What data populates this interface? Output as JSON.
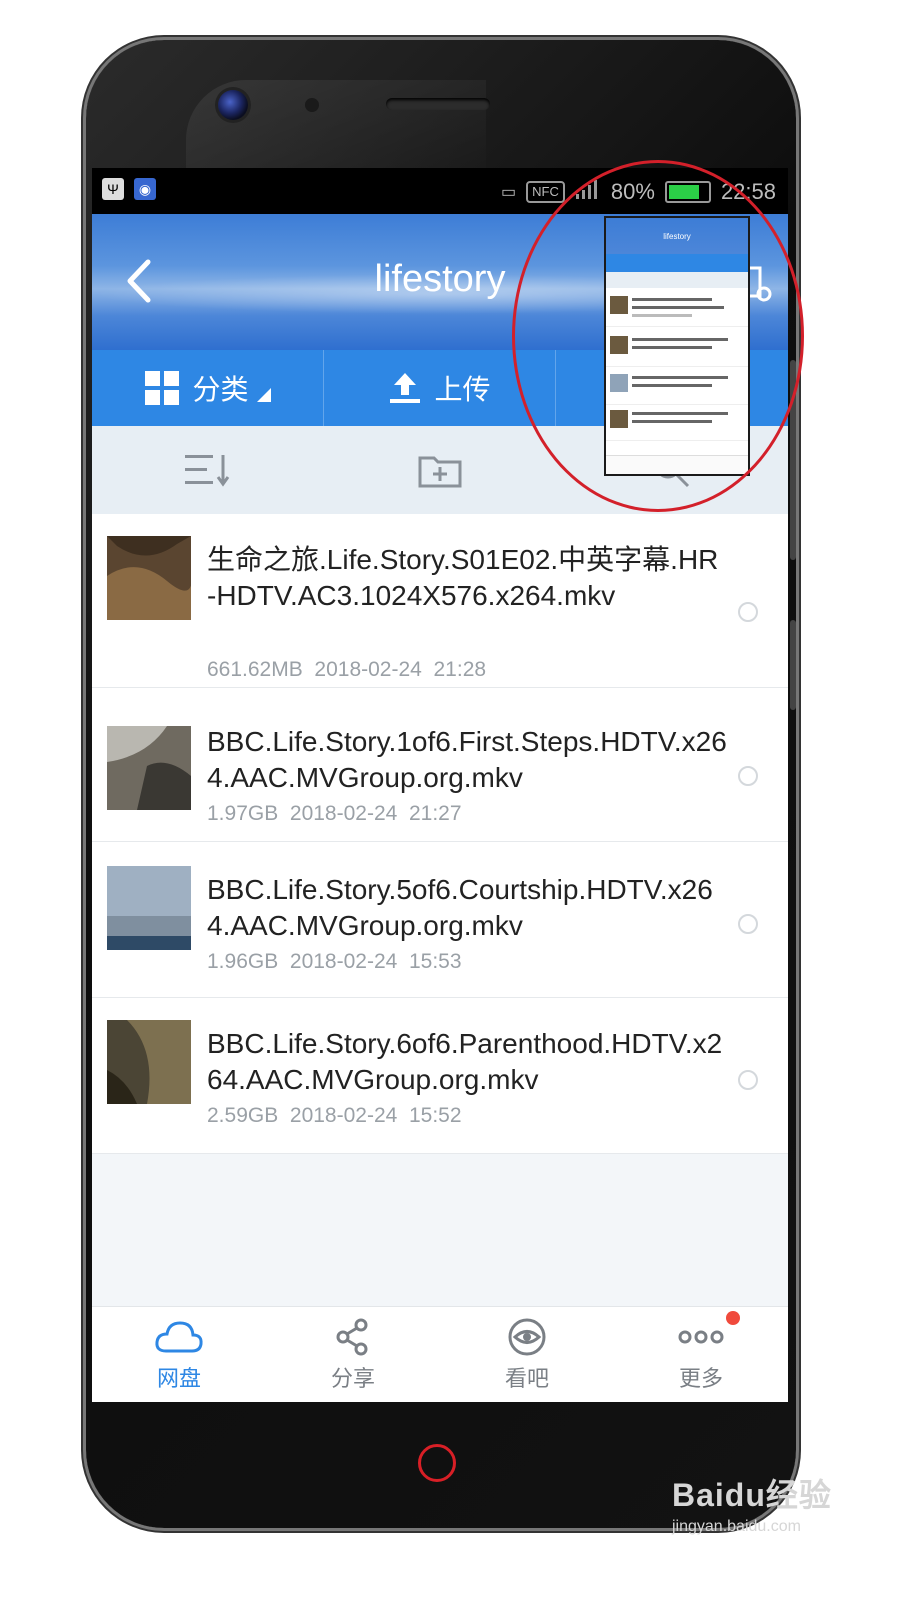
{
  "status_bar": {
    "nfc": "NFC",
    "battery": "80%",
    "time": "22:58"
  },
  "header": {
    "title": "lifestory"
  },
  "action_bar": {
    "items": [
      {
        "label": "分类"
      },
      {
        "label": "上传"
      }
    ]
  },
  "files": [
    {
      "name": "生命之旅.Life.Story.S01E02.中英字幕.HR-HDTV.AC3.1024X576.x264.mkv",
      "size": "661.62MB",
      "date": "2018-02-24  21:28",
      "thumb_colors": [
        "#5a4530",
        "#8a6a44",
        "#3e2f20"
      ]
    },
    {
      "name": "BBC.Life.Story.1of6.First.Steps.HDTV.x264.AAC.MVGroup.org.mkv",
      "size": "1.97GB",
      "date": "2018-02-24  21:27",
      "thumb_colors": [
        "#b9b7b0",
        "#6f6a60",
        "#3a3833"
      ]
    },
    {
      "name": "BBC.Life.Story.5of6.Courtship.HDTV.x264.AAC.MVGroup.org.mkv",
      "size": "1.96GB",
      "date": "2018-02-24  15:53",
      "thumb_colors": [
        "#9fb0c2",
        "#7f8f9f",
        "#2e4a66"
      ]
    },
    {
      "name": "BBC.Life.Story.6of6.Parenthood.HDTV.x264.AAC.MVGroup.org.mkv",
      "size": "2.59GB",
      "date": "2018-02-24  15:52",
      "thumb_colors": [
        "#4b4535",
        "#7d7050",
        "#2a2518"
      ]
    }
  ],
  "tabbar": {
    "tabs": [
      {
        "label": "网盘",
        "icon": "cloud-icon",
        "active": true
      },
      {
        "label": "分享",
        "icon": "share-icon",
        "active": false
      },
      {
        "label": "看吧",
        "icon": "eye-icon",
        "active": false
      },
      {
        "label": "更多",
        "icon": "more-icon",
        "active": false
      }
    ]
  },
  "mini_screenshot": {
    "title": "lifestory"
  },
  "watermark": {
    "main": "Baidu经验",
    "sub": "jingyan.baidu.com"
  },
  "colors": {
    "accent": "#2e87e4",
    "highlight_ring": "#d3202a",
    "notification_dot": "#f04a3c"
  }
}
